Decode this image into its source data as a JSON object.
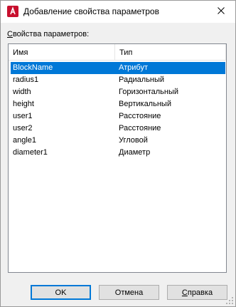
{
  "window": {
    "title": "Добавление свойства параметров",
    "app_icon": "autocad-a-icon",
    "close_icon": "close-icon"
  },
  "section_label": "Свойства параметров:",
  "section_label_accel": "С",
  "section_label_rest": "войства параметров:",
  "list": {
    "columns": [
      "Имя",
      "Тип"
    ],
    "rows": [
      {
        "name": "BlockName",
        "type": "Атрибут",
        "selected": true
      },
      {
        "name": "radius1",
        "type": "Радиальный",
        "selected": false
      },
      {
        "name": "width",
        "type": "Горизонтальный",
        "selected": false
      },
      {
        "name": "height",
        "type": "Вертикальный",
        "selected": false
      },
      {
        "name": "user1",
        "type": "Расстояние",
        "selected": false
      },
      {
        "name": "user2",
        "type": "Расстояние",
        "selected": false
      },
      {
        "name": "angle1",
        "type": "Угловой",
        "selected": false
      },
      {
        "name": "diameter1",
        "type": "Диаметр",
        "selected": false
      }
    ]
  },
  "buttons": {
    "ok": "OK",
    "cancel": "Отмена",
    "help_accel": "С",
    "help_rest": "правка"
  },
  "colors": {
    "selection": "#0078d7",
    "app_icon": "#c8102e"
  }
}
